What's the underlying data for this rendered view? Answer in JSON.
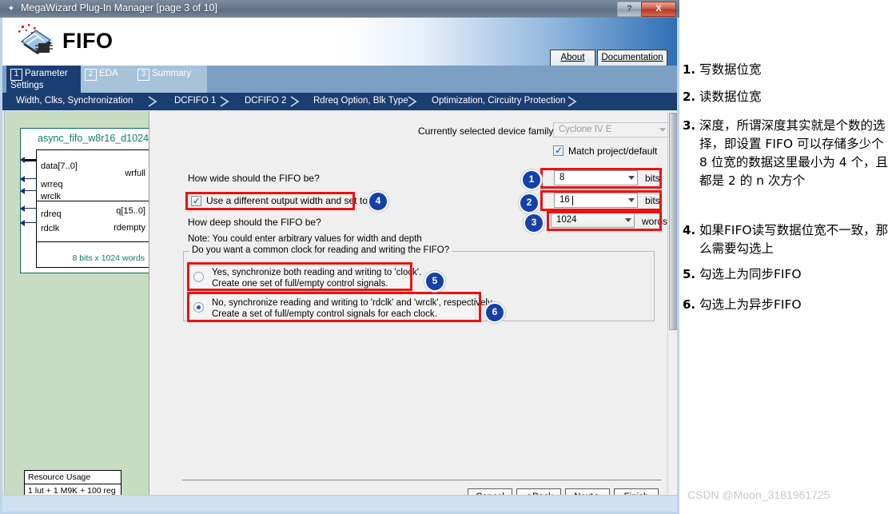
{
  "window": {
    "title": "MegaWizard Plug-In Manager [page 3 of 10]",
    "icon": "wizard-wand-icon",
    "help_label": "?",
    "close_label": "X"
  },
  "banner": {
    "product": "FIFO",
    "about_label": "About",
    "documentation_label": "Documentation"
  },
  "tabs": [
    {
      "num": "1",
      "label": "Parameter Settings",
      "selected": true
    },
    {
      "num": "2",
      "label": "EDA",
      "selected": false
    },
    {
      "num": "3",
      "label": "Summary",
      "selected": false
    }
  ],
  "breadcrumb": [
    "Width, Clks, Synchronization",
    "DCFIFO 1",
    "DCFIFO 2",
    "Rdreq Option, Blk Type",
    "Optimization, Circuitry Protection"
  ],
  "preview": {
    "module_name": "async_fifo_w8r16_d1024",
    "inputs_top": [
      "data[7..0]",
      "wrreq",
      "wrclk"
    ],
    "outputs_top": [
      "wrfull"
    ],
    "inputs_bottom": [
      "rdreq",
      "rdclk"
    ],
    "outputs_bottom": [
      "q[15..0]",
      "rdempty"
    ],
    "capacity": "8 bits x 1024 words",
    "resource_header": "Resource Usage",
    "resource_value": "1 lut + 1 M9K + 100 reg"
  },
  "form": {
    "device_family_label": "Currently selected device family:",
    "device_family_value": "Cyclone IV E",
    "match_project_label": "Match project/default",
    "match_project_checked": true,
    "width_question": "How wide should the FIFO be?",
    "width_value": "8",
    "width_unit": "bits",
    "output_width_checkbox": "Use a different output width and set to",
    "output_width_checked": true,
    "output_width_value": "16",
    "output_width_unit": "bits",
    "depth_question": "How deep should the FIFO be?",
    "depth_value": "1024",
    "depth_unit": "words",
    "note": "Note: You could enter arbitrary values for width and depth",
    "clock_group_title": "Do you want a common clock for reading and writing the FIFO?",
    "clock_option_yes_line1": "Yes, synchronize both reading and writing to 'clock'.",
    "clock_option_yes_line2": "Create one set of full/empty control signals.",
    "clock_option_no_line1": "No, synchronize reading and writing to 'rdclk' and 'wrclk', respectively.",
    "clock_option_no_line2": "Create a set of full/empty control signals for each clock.",
    "clock_selected": "no"
  },
  "footer": {
    "cancel": "Cancel",
    "back": "< Back",
    "next": "Next >",
    "finish": "Finish"
  },
  "annotations": {
    "badges": [
      "1",
      "2",
      "3",
      "4",
      "5",
      "6"
    ],
    "accent_red": "#ee1111",
    "badge_blue": "#1440a8"
  },
  "notes": [
    {
      "num": "1.",
      "text": "写数据位宽"
    },
    {
      "num": "2.",
      "text": "读数据位宽"
    },
    {
      "num": "3.",
      "text": "深度，所谓深度其实就是个数的选择，即设置 FIFO 可以存储多少个 8 位宽的数据这里最小为 4 个，且都是 2 的 n 次方个"
    },
    {
      "num": "4.",
      "text": "如果FIFO读写数据位宽不一致，那么需要勾选上"
    },
    {
      "num": "5.",
      "text": "勾选上为同步FIFO"
    },
    {
      "num": "6.",
      "text": "勾选上为异步FIFO"
    }
  ],
  "watermark": "CSDN @Moon_3181961725"
}
